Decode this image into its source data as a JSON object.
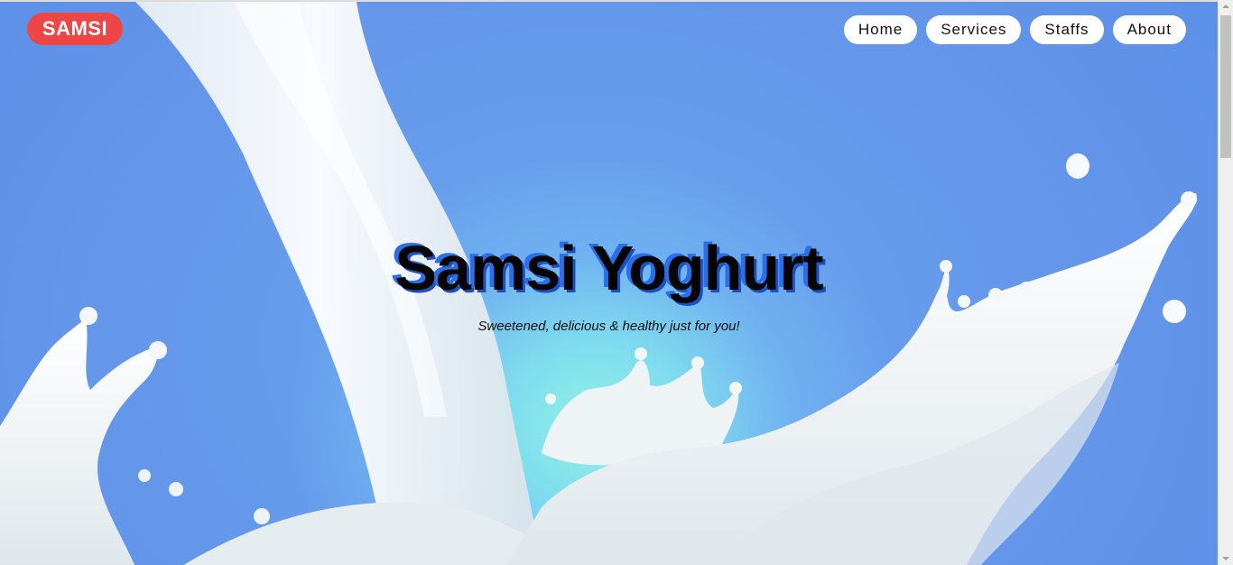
{
  "brand": {
    "logo_text": "SAMSI",
    "accent_color": "#ee4545"
  },
  "nav": {
    "items": [
      {
        "label": "Home"
      },
      {
        "label": "Services"
      },
      {
        "label": "Staffs"
      },
      {
        "label": "About"
      }
    ]
  },
  "hero": {
    "title": "Samsi Yoghurt",
    "subtitle": "Sweetened, delicious & healthy just for you!",
    "background_color": "#6496ea",
    "title_shadow_color": "#2a6fe8"
  },
  "icons": {
    "scroll_up": "chevron-up-icon",
    "scroll_down": "chevron-down-icon"
  }
}
